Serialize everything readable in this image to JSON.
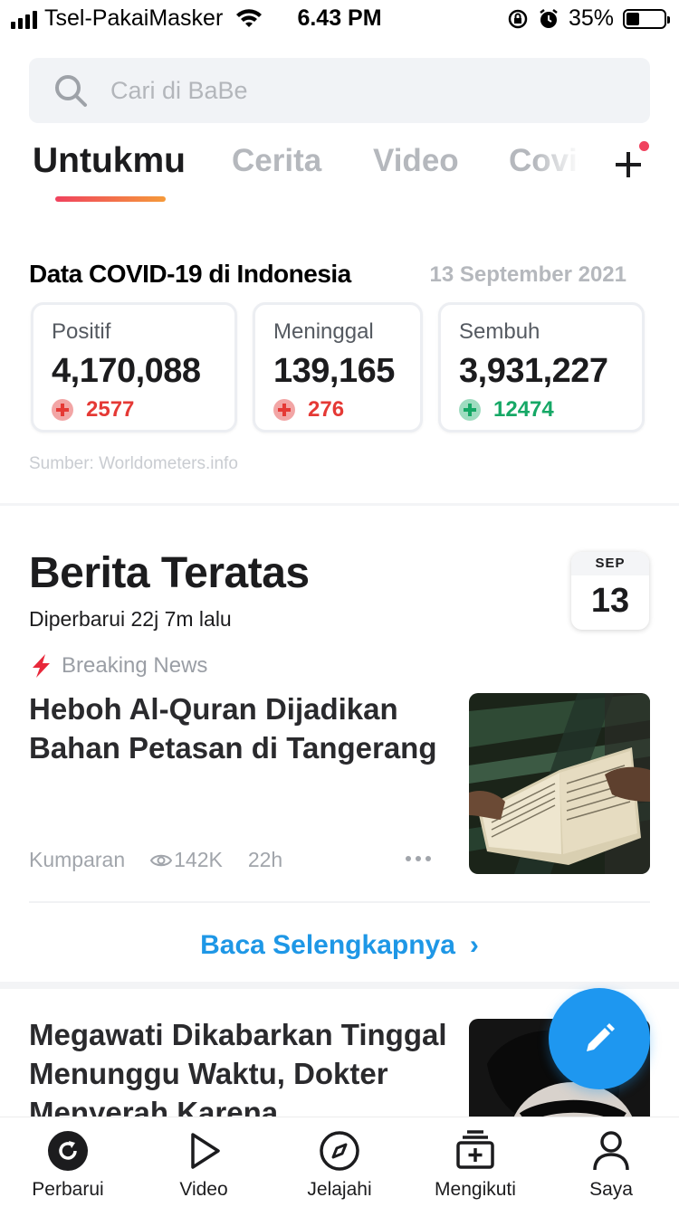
{
  "status_bar": {
    "carrier": "Tsel-PakaiMasker",
    "time": "6.43 PM",
    "battery": "35%"
  },
  "search": {
    "placeholder": "Cari di BaBe"
  },
  "tabs": [
    {
      "label": "Untukmu",
      "active": true
    },
    {
      "label": "Cerita"
    },
    {
      "label": "Video"
    },
    {
      "label": "Covid"
    }
  ],
  "covid": {
    "title": "Data COVID-19 di Indonesia",
    "date": "13 September 2021",
    "source": "Sumber: Worldometers.info",
    "stats": [
      {
        "label": "Positif",
        "value": "4,170,088",
        "delta": "2577",
        "tone": "red"
      },
      {
        "label": "Meninggal",
        "value": "139,165",
        "delta": "276",
        "tone": "red"
      },
      {
        "label": "Sembuh",
        "value": "3,931,227",
        "delta": "12474",
        "tone": "green"
      }
    ]
  },
  "top_news": {
    "title": "Berita Teratas",
    "updated": "Diperbarui 22j 7m lalu",
    "calendar": {
      "month": "SEP",
      "day": "13"
    },
    "tag": "Breaking News",
    "article1": {
      "headline": "Heboh Al-Quran Dijadikan Bahan Petasan di Tangerang",
      "source": "Kumparan",
      "views": "142K",
      "age": "22h"
    },
    "read_more": "Baca Selengkapnya",
    "article2": {
      "headline": "Megawati Dikabarkan Tinggal Menunggu Waktu, Dokter Menyerah Karena"
    }
  },
  "colors": {
    "accent": "#1e97e6",
    "fab": "#1e97f0",
    "gradient_start": "#f0425e",
    "gradient_end": "#f59a3a"
  },
  "bottom_nav": [
    {
      "label": "Perbarui",
      "icon": "refresh-icon"
    },
    {
      "label": "Video",
      "icon": "play-icon"
    },
    {
      "label": "Jelajahi",
      "icon": "compass-icon"
    },
    {
      "label": "Mengikuti",
      "icon": "following-icon"
    },
    {
      "label": "Saya",
      "icon": "profile-icon"
    }
  ]
}
